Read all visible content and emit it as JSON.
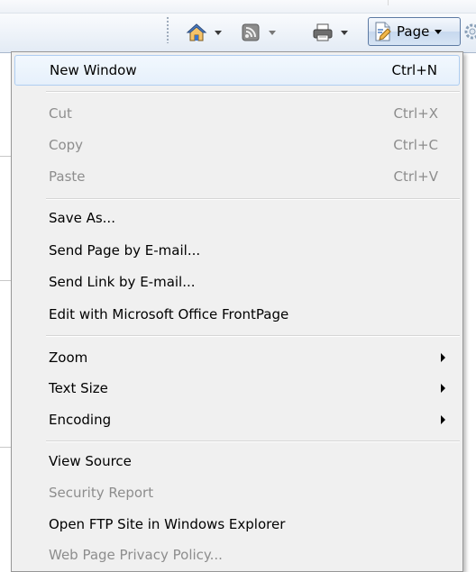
{
  "toolbar": {
    "buttons": [
      {
        "icon": "home-icon"
      },
      {
        "icon": "feeds-icon"
      },
      {
        "icon": "print-icon"
      }
    ],
    "page_label": "Page",
    "page_icon": "page-icon",
    "tools_icon": "gear-icon"
  },
  "menu": {
    "groups": [
      {
        "items": [
          {
            "label": "New Window",
            "shortcut": "Ctrl+N",
            "enabled": true,
            "highlighted": true
          }
        ]
      },
      {
        "items": [
          {
            "label": "Cut",
            "shortcut": "Ctrl+X",
            "enabled": false
          },
          {
            "label": "Copy",
            "shortcut": "Ctrl+C",
            "enabled": false
          },
          {
            "label": "Paste",
            "shortcut": "Ctrl+V",
            "enabled": false
          }
        ]
      },
      {
        "items": [
          {
            "label": "Save As...",
            "enabled": true
          },
          {
            "label": "Send Page by E-mail...",
            "enabled": true
          },
          {
            "label": "Send Link by E-mail...",
            "enabled": true
          },
          {
            "label": "Edit with Microsoft Office FrontPage",
            "enabled": true
          }
        ]
      },
      {
        "items": [
          {
            "label": "Zoom",
            "enabled": true,
            "submenu": true
          },
          {
            "label": "Text Size",
            "enabled": true,
            "submenu": true
          },
          {
            "label": "Encoding",
            "enabled": true,
            "submenu": true
          }
        ]
      },
      {
        "items": [
          {
            "label": "View Source",
            "enabled": true
          },
          {
            "label": "Security Report",
            "enabled": false
          },
          {
            "label": "Open FTP Site in Windows Explorer",
            "enabled": true
          },
          {
            "label": "Web Page Privacy Policy...",
            "enabled": false
          }
        ]
      }
    ]
  },
  "colors": {
    "menu_bg": "#f0f0f0",
    "disabled_text": "#8d8d8d",
    "highlight_border": "#aecdf1"
  }
}
